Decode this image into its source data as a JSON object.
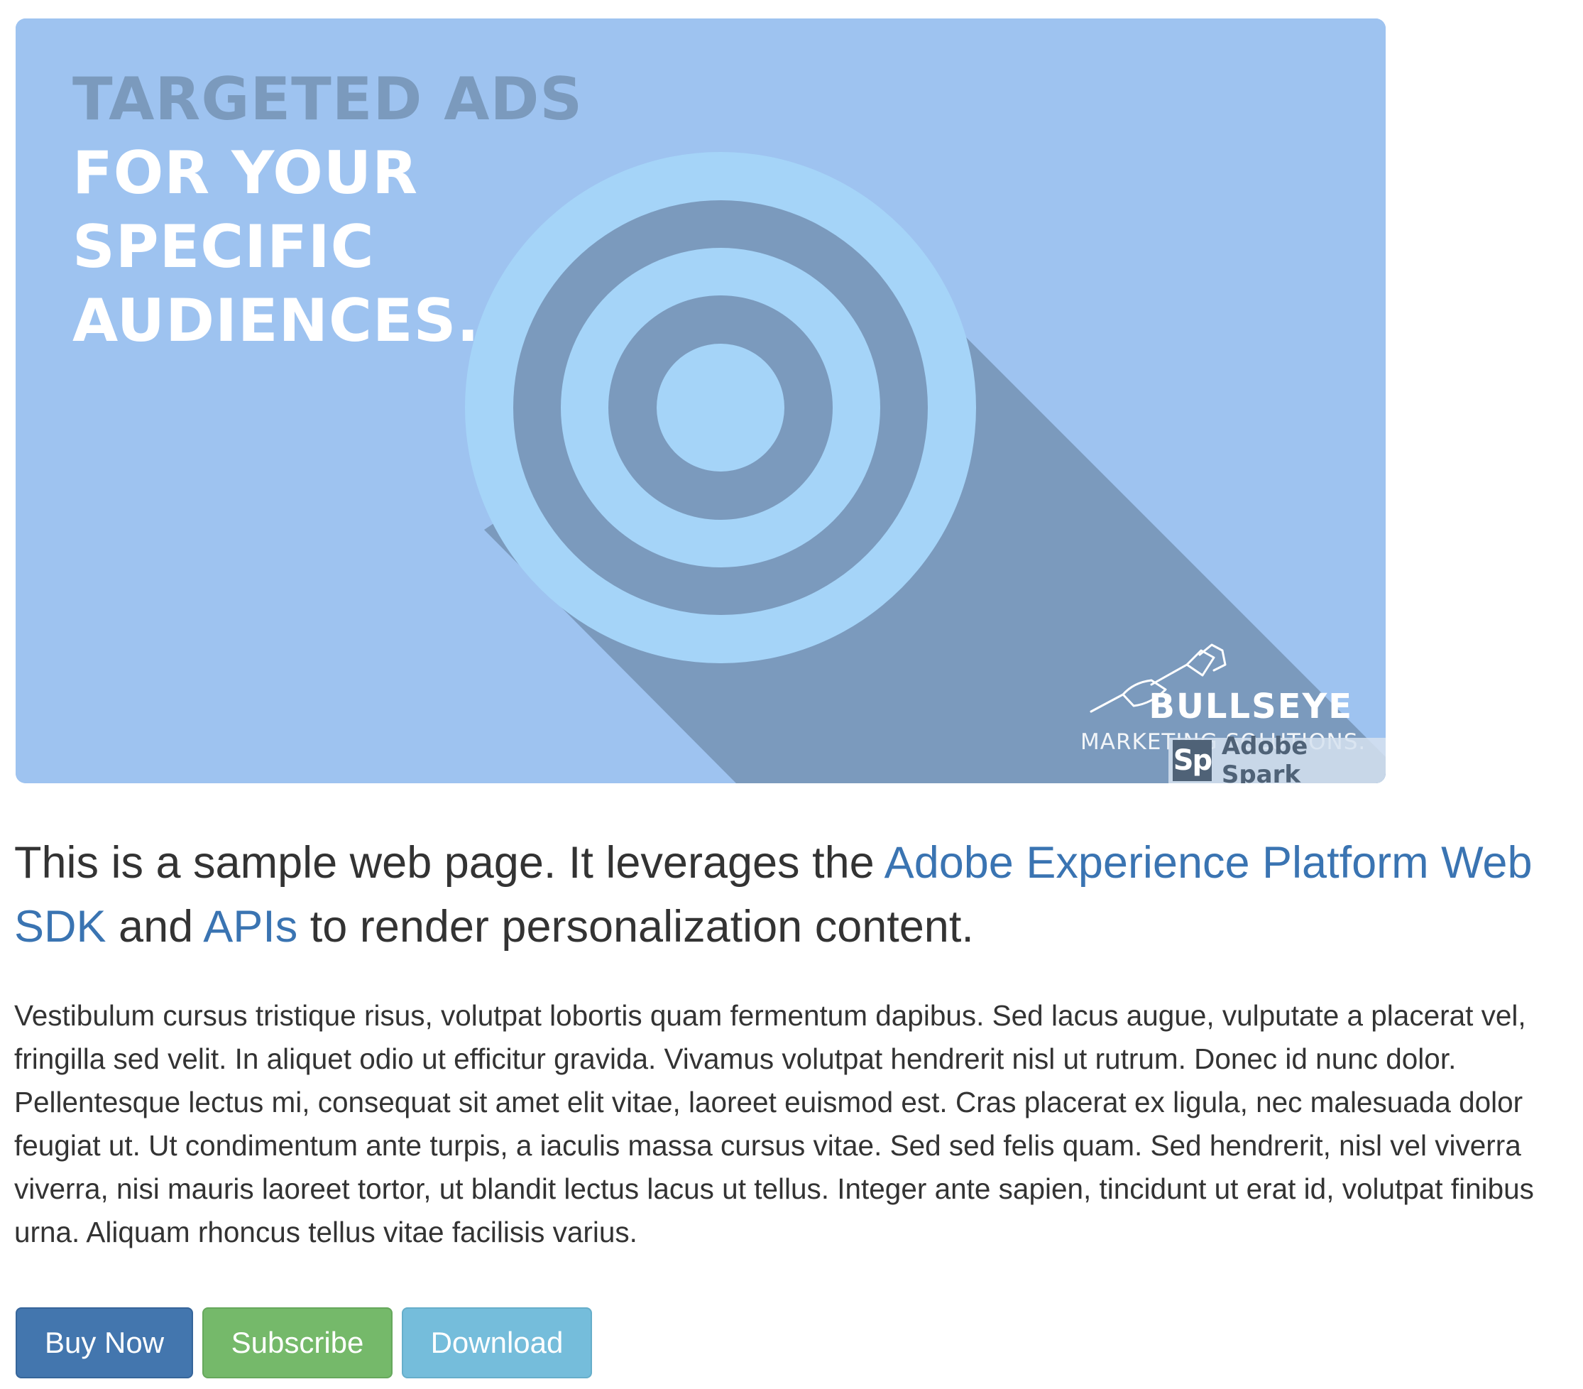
{
  "hero": {
    "headline_line1": "TARGETED ADS",
    "headline_line2": "FOR YOUR",
    "headline_line3": "SPECIFIC",
    "headline_line4": "AUDIENCES.",
    "brand_name": "BULLSEYE",
    "brand_tagline": "MARKETING SOLUTIONS.",
    "badge_logo": "Sp",
    "badge_text": "Adobe Spark",
    "colors": {
      "background": "#9ec3f0",
      "target_light": "#a5d4f8",
      "target_dark": "#7b9abd"
    }
  },
  "lead": {
    "text_before": "This is a sample web page. It leverages the ",
    "link1": "Adobe Experience Platform Web SDK",
    "text_middle": " and ",
    "link2": "APIs",
    "text_after": " to render personalization content."
  },
  "body": {
    "paragraph": "Vestibulum cursus tristique risus, volutpat lobortis quam fermentum dapibus. Sed lacus augue, vulputate a placerat vel, fringilla sed velit. In aliquet odio ut efficitur gravida. Vivamus volutpat hendrerit nisl ut rutrum. Donec id nunc dolor. Pellentesque lectus mi, consequat sit amet elit vitae, laoreet euismod est. Cras placerat ex ligula, nec malesuada dolor feugiat ut. Ut condimentum ante turpis, a iaculis massa cursus vitae. Sed sed felis quam. Sed hendrerit, nisl vel viverra viverra, nisi mauris laoreet tortor, ut blandit lectus lacus ut tellus. Integer ante sapien, tincidunt ut erat id, volutpat finibus urna. Aliquam rhoncus tellus vitae facilisis varius."
  },
  "buttons": {
    "buy_now": "Buy Now",
    "subscribe": "Subscribe",
    "download": "Download",
    "colors": {
      "buy_now": "#4376ae",
      "subscribe": "#75b96a",
      "download": "#75bddb"
    }
  }
}
